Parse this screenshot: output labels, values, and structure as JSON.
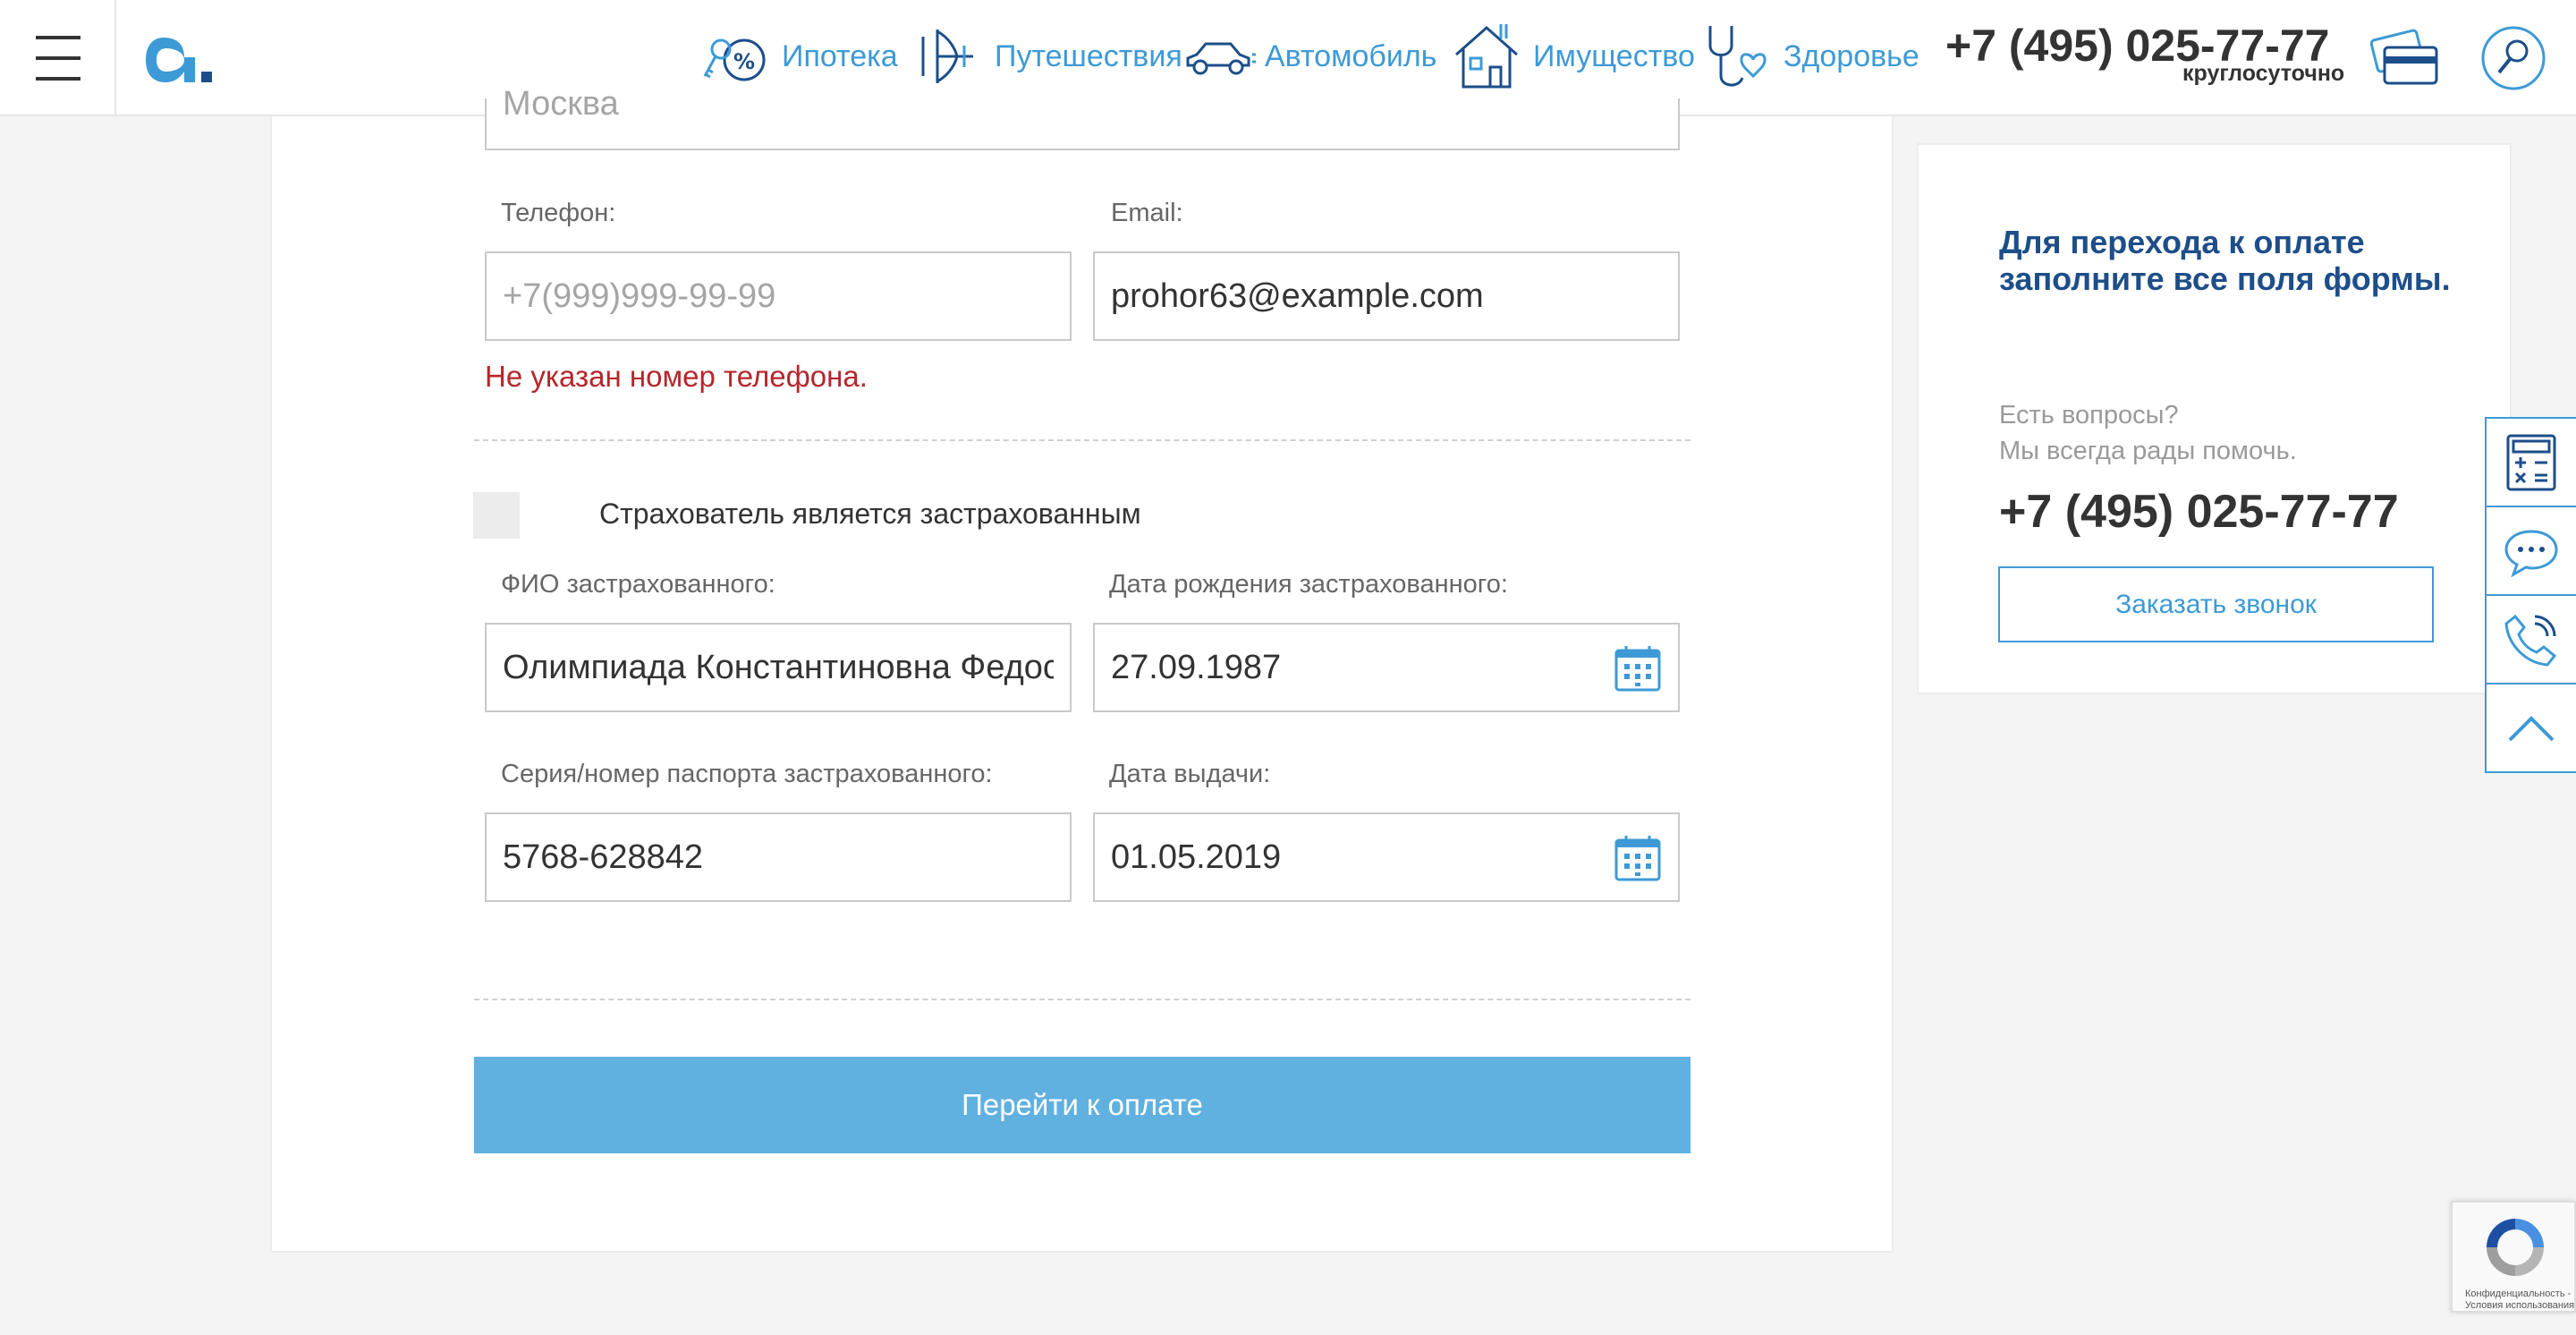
{
  "header": {
    "nav": [
      {
        "label": "Ипотека",
        "icon": "mortgage-icon"
      },
      {
        "label": "Путешествия",
        "icon": "plane-icon"
      },
      {
        "label": "Автомобиль",
        "icon": "car-icon"
      },
      {
        "label": "Имущество",
        "icon": "house-icon"
      },
      {
        "label": "Здоровье",
        "icon": "stethoscope-icon"
      }
    ],
    "phone": "+7 (495) 025-77-77",
    "phone_note": "круглосуточно"
  },
  "form": {
    "city_value": "Москва",
    "phone_label": "Телефон:",
    "phone_placeholder": "+7(999)999-99-99",
    "email_label": "Email:",
    "email_value": "prohor63@example.com",
    "phone_error": "Не указан номер телефона.",
    "insured_checkbox_label": "Страхователь является застрахованным",
    "insured_name_label": "ФИО застрахованного:",
    "insured_name_value": "Олимпиада Константиновна Федосеева",
    "birth_date_label": "Дата рождения застрахованного:",
    "birth_date_value": "27.09.1987",
    "passport_label": "Серия/номер паспорта застрахованного:",
    "passport_value": "5768-628842",
    "issue_date_label": "Дата выдачи:",
    "issue_date_value": "01.05.2019",
    "pay_button": "Перейти к оплате"
  },
  "side": {
    "title": "Для перехода к оплате заполните все поля формы.",
    "question_line1": "Есть вопросы?",
    "question_line2": "Мы всегда рады помочь.",
    "phone": "+7 (495) 025-77-77",
    "callback_button": "Заказать звонок"
  },
  "float_bar": [
    "calculator-icon",
    "chat-icon",
    "phone-call-icon",
    "arrow-up-icon"
  ],
  "recaptcha": {
    "line1": "Конфиденциальность -",
    "line2": "Условия использования"
  },
  "colors": {
    "accent": "#3d9ad6",
    "button": "#61b1e0",
    "title": "#1d4e89",
    "error": "#b5262b"
  }
}
